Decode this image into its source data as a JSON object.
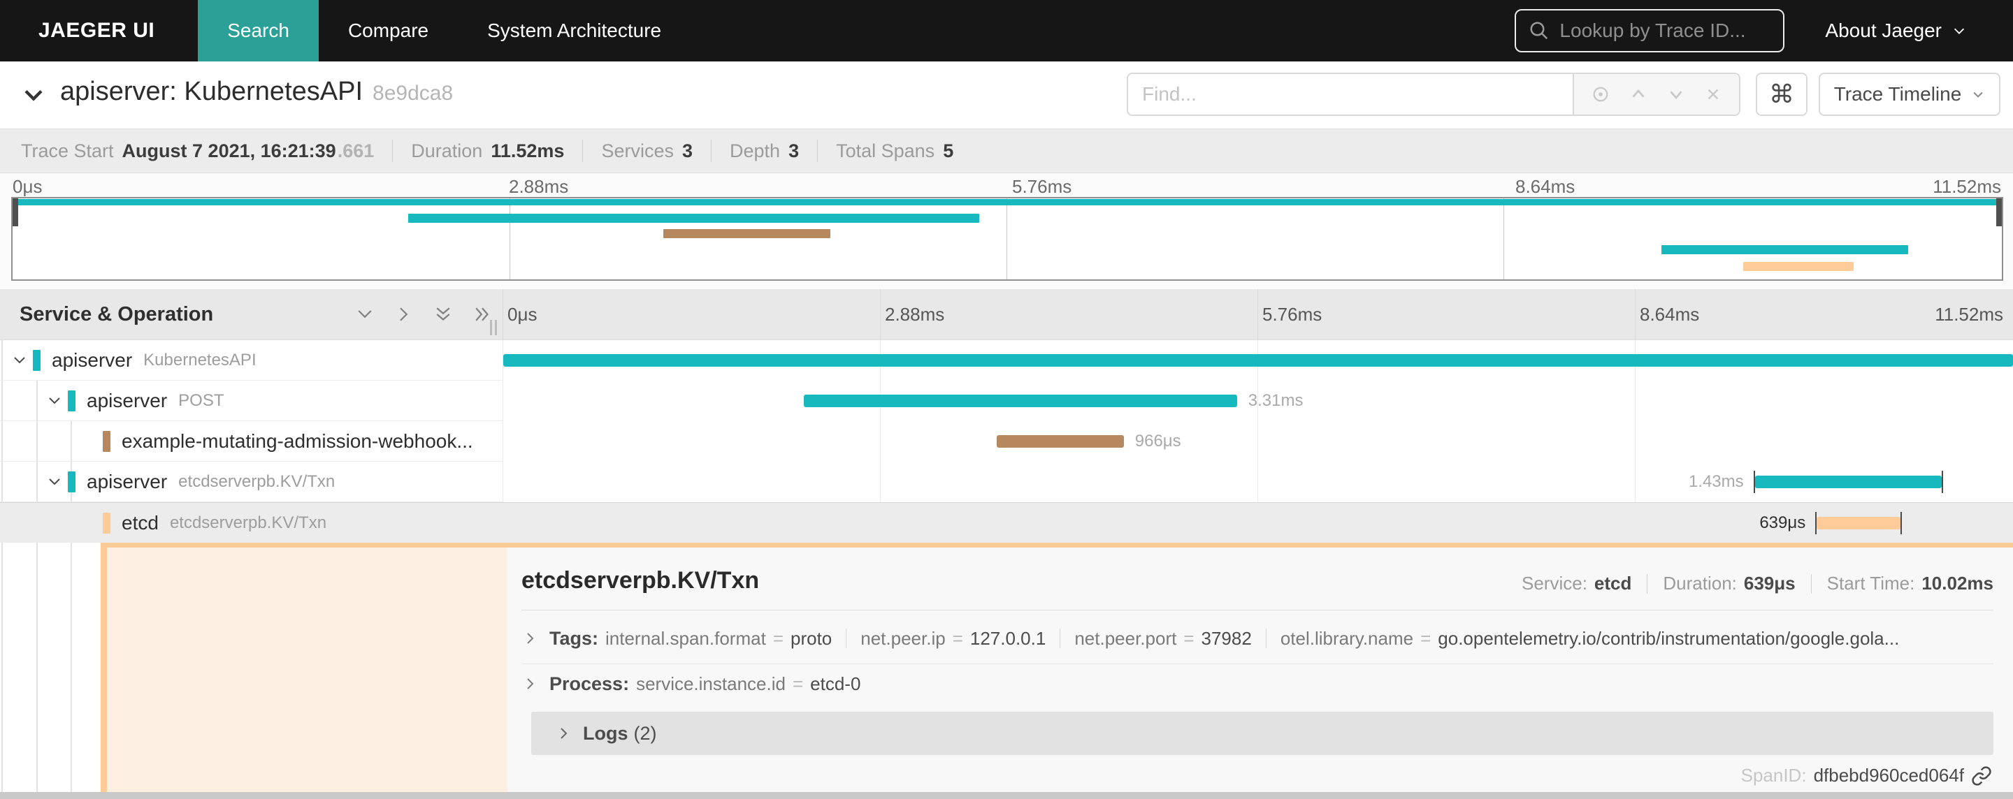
{
  "navbar": {
    "brand": "JAEGER UI",
    "tabs": [
      {
        "label": "Search",
        "active": true
      },
      {
        "label": "Compare",
        "active": false
      },
      {
        "label": "System Architecture",
        "active": false
      }
    ],
    "lookup_placeholder": "Lookup by Trace ID...",
    "about_label": "About Jaeger"
  },
  "trace_header": {
    "title": "apiserver: KubernetesAPI",
    "trace_id_short": "8e9dca8",
    "find_placeholder": "Find...",
    "shortcut_glyph": "⌘",
    "view_label": "Trace Timeline"
  },
  "summary": {
    "items": [
      {
        "label": "Trace Start",
        "value": "August 7 2021, 16:21:39",
        "suffix": ".661"
      },
      {
        "label": "Duration",
        "value": "11.52ms"
      },
      {
        "label": "Services",
        "value": "3"
      },
      {
        "label": "Depth",
        "value": "3"
      },
      {
        "label": "Total Spans",
        "value": "5"
      }
    ]
  },
  "timeline": {
    "left_header": "Service & Operation",
    "ticks": [
      "0μs",
      "2.88ms",
      "5.76ms",
      "8.64ms",
      "11.52ms"
    ]
  },
  "spans": [
    {
      "service": "apiserver",
      "operation": "KubernetesAPI",
      "depth": 0,
      "has_children": true,
      "color": "#17B8BE",
      "start_pct": 0,
      "width_pct": 100,
      "duration_label": "",
      "label_side": "none",
      "edge_ticks": false,
      "selected": false
    },
    {
      "service": "apiserver",
      "operation": "POST",
      "depth": 1,
      "has_children": true,
      "color": "#17B8BE",
      "start_pct": 19.9,
      "width_pct": 28.7,
      "duration_label": "3.31ms",
      "label_side": "right",
      "edge_ticks": false,
      "selected": false
    },
    {
      "service": "example-mutating-admission-webhook...",
      "operation": "",
      "depth": 2,
      "has_children": false,
      "color": "#B7885E",
      "start_pct": 32.7,
      "width_pct": 8.4,
      "duration_label": "966μs",
      "label_side": "right",
      "edge_ticks": false,
      "selected": false
    },
    {
      "service": "apiserver",
      "operation": "etcdserverpb.KV/Txn",
      "depth": 1,
      "has_children": true,
      "color": "#17B8BE",
      "start_pct": 82.9,
      "width_pct": 12.4,
      "duration_label": "1.43ms",
      "label_side": "left",
      "edge_ticks": true,
      "selected": false
    },
    {
      "service": "etcd",
      "operation": "etcdserverpb.KV/Txn",
      "depth": 2,
      "has_children": false,
      "color": "#FFCB99",
      "start_pct": 87.0,
      "width_pct": 5.55,
      "duration_label": "639μs",
      "label_side": "left",
      "edge_ticks": true,
      "selected": true
    }
  ],
  "detail": {
    "operation": "etcdserverpb.KV/Txn",
    "meta": [
      {
        "label": "Service:",
        "value": "etcd"
      },
      {
        "label": "Duration:",
        "value": "639μs"
      },
      {
        "label": "Start Time:",
        "value": "10.02ms"
      }
    ],
    "tags_label": "Tags:",
    "tags": [
      {
        "key": "internal.span.format",
        "value": "proto"
      },
      {
        "key": "net.peer.ip",
        "value": "127.0.0.1"
      },
      {
        "key": "net.peer.port",
        "value": "37982"
      },
      {
        "key": "otel.library.name",
        "value": "go.opentelemetry.io/contrib/instrumentation/google.gola..."
      }
    ],
    "process_label": "Process:",
    "process": [
      {
        "key": "service.instance.id",
        "value": "etcd-0"
      }
    ],
    "logs_label": "Logs",
    "logs_count": "(2)",
    "span_id_label": "SpanID:",
    "span_id": "dfbebd960ced064f"
  },
  "colors": {
    "nav_bg": "#161616",
    "tab_active": "#2aa096",
    "span_teal": "#17B8BE",
    "span_brown": "#B7885E",
    "span_peach": "#FFCB99",
    "selected_row_bg": "#ececec"
  }
}
